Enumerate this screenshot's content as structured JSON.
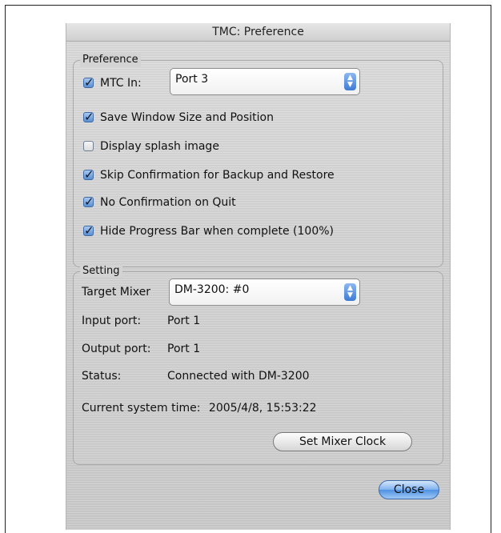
{
  "window": {
    "title": "TMC: Preference"
  },
  "preference": {
    "legend": "Preference",
    "mtc_in": {
      "label": "MTC In:",
      "checked": true,
      "value": "Port 3"
    },
    "options": [
      {
        "label": "Save Window Size and Position",
        "checked": true
      },
      {
        "label": "Display splash image",
        "checked": false
      },
      {
        "label": "Skip Confirmation for Backup and Restore",
        "checked": true
      },
      {
        "label": "No Confirmation on Quit",
        "checked": true
      },
      {
        "label": "Hide Progress Bar when complete (100%)",
        "checked": true
      }
    ]
  },
  "setting": {
    "legend": "Setting",
    "target_mixer_label": "Target Mixer",
    "target_mixer_value": "DM-3200: #0",
    "input_port_label": "Input port:",
    "input_port_value": "Port 1",
    "output_port_label": "Output port:",
    "output_port_value": "Port 1",
    "status_label": "Status:",
    "status_value": "Connected with DM-3200",
    "system_time_label": "Current system time:",
    "system_time_value": "2005/4/8, 15:53:22",
    "set_clock_button": "Set Mixer Clock"
  },
  "close_button": "Close"
}
